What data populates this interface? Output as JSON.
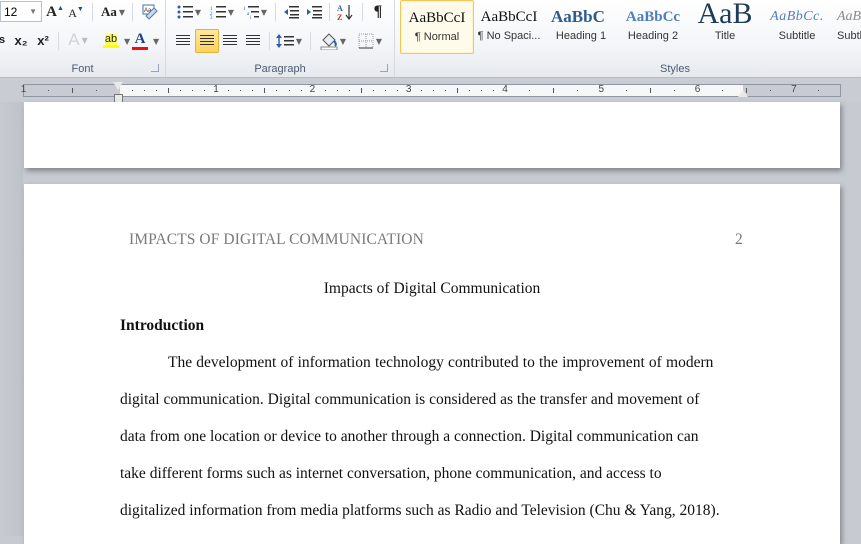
{
  "ribbon": {
    "font_group": {
      "label": "Font",
      "font_size": "12",
      "grow_font": "A",
      "shrink_font": "A",
      "change_case": "Aa",
      "subscript": "x₂",
      "superscript": "x²",
      "text_effects": "A",
      "highlight": "ab",
      "font_color": "A",
      "highlight_color": "#ffff00",
      "font_color_value": "#e81010"
    },
    "paragraph_group": {
      "label": "Paragraph",
      "active_alignment": "center"
    },
    "styles_group": {
      "label": "Styles",
      "styles": [
        {
          "sample": "AaBbCcI",
          "name": "¶ Normal",
          "active": true
        },
        {
          "sample": "AaBbCcI",
          "name": "¶ No Spaci..."
        },
        {
          "sample": "AaBbC",
          "name": "Heading 1"
        },
        {
          "sample": "AaBbCc",
          "name": "Heading 2"
        },
        {
          "sample": "AaB",
          "name": "Title"
        },
        {
          "sample": "AaBbCc.",
          "name": "Subtitle"
        },
        {
          "sample": "AaBbCc",
          "name": "Subtle"
        }
      ]
    }
  },
  "ruler": {
    "numbers": [
      "1",
      "1",
      "2",
      "3",
      "4",
      "5",
      "6",
      "7"
    ]
  },
  "document": {
    "running_head": "IMPACTS OF DIGITAL COMMUNICATION",
    "page_number": "2",
    "title": "Impacts of Digital Communication",
    "heading": "Introduction",
    "lines": [
      "The development of information technology contributed to the improvement of modern",
      "digital communication. Digital communication is considered as the transfer and movement of",
      "data from one location or device to another through a connection. Digital communication can",
      "take different forms such as internet conversation, phone communication, and access to",
      "digitalized information from media platforms such as Radio and Television (Chu & Yang, 2018)."
    ]
  }
}
